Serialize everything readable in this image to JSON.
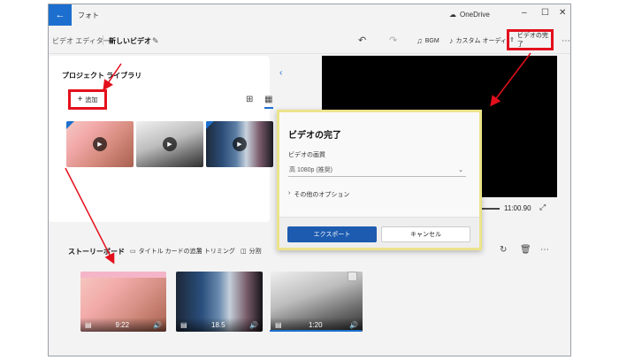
{
  "window": {
    "app_title": "フォト",
    "back_icon": "back-arrow-icon",
    "onedrive_label": "OneDrive",
    "controls": [
      "minimize",
      "maximize",
      "close"
    ]
  },
  "toolbar": {
    "breadcrumb_editor": "ビデオ エディター",
    "breadcrumb_project": "新しいビデオ",
    "undo_icon": "undo-icon",
    "redo_icon": "redo-icon",
    "bgm_label": "BGM",
    "custom_audio_label": "カスタム オーディオ",
    "finish_label": "ビデオの完了",
    "more_icon": "more-icon"
  },
  "library": {
    "title": "プロジェクト ライブラリ",
    "add_label": "追加"
  },
  "preview": {
    "time": "11:00.90"
  },
  "storyboard": {
    "title": "ストーリーボード",
    "tools": {
      "title_card": "タイトル カードの追加",
      "trim": "トリミング",
      "split": "分割"
    },
    "clips": [
      {
        "duration": "9:22"
      },
      {
        "duration": "18.5"
      },
      {
        "duration": "1:20"
      }
    ]
  },
  "dialog": {
    "title": "ビデオの完了",
    "quality_label": "ビデオの画質",
    "quality_value": "高 1080p (推奨)",
    "more_options": "その他のオプション",
    "export_label": "エクスポート",
    "cancel_label": "キャンセル"
  },
  "colors": {
    "accent": "#1c6fce",
    "annotation_red": "#e3101c",
    "dialog_highlight": "#ece38b"
  }
}
